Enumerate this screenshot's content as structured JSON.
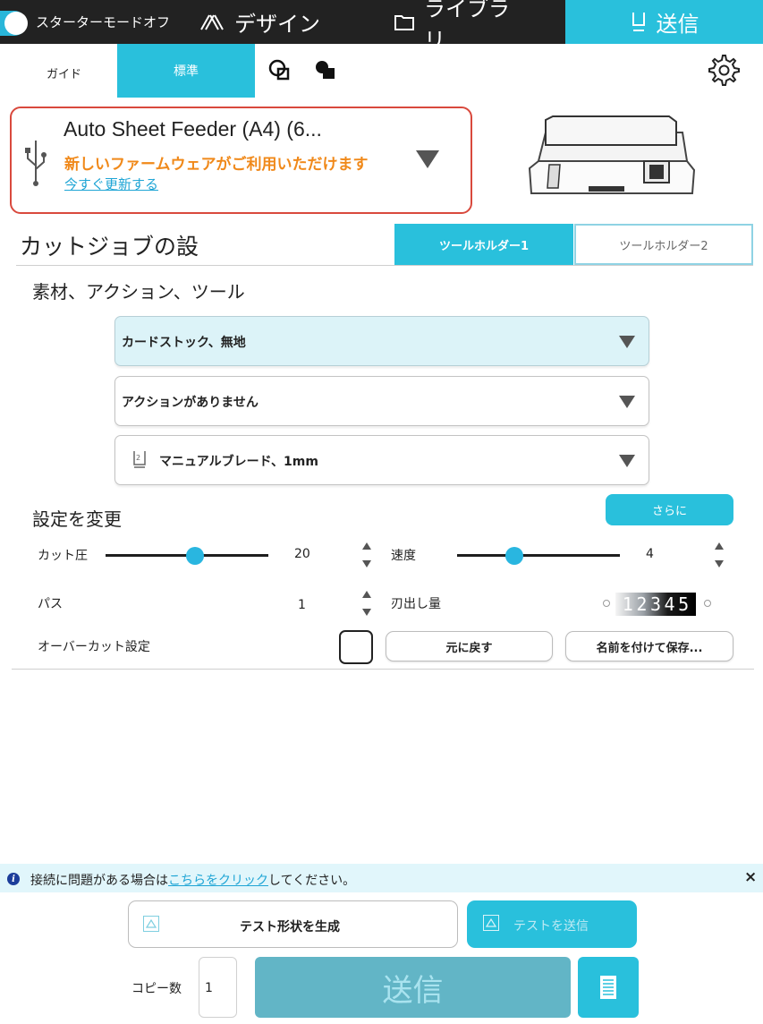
{
  "topbar": {
    "starter_mode": "スターターモードオフ",
    "tabs": [
      {
        "label": "デザイン",
        "icon": "design-icon"
      },
      {
        "label": "ライブラリ",
        "icon": "folder-icon"
      },
      {
        "label": "送信",
        "icon": "send-icon",
        "active": true
      }
    ]
  },
  "mode": {
    "guide": "ガイド",
    "standard": "標準"
  },
  "machine": {
    "name": "Auto Sheet Feeder (A4) (6...",
    "firmware_message": "新しいファームウェアがご利用いただけます",
    "update_link": "今すぐ更新する"
  },
  "cut_job": {
    "title": "カットジョブの設",
    "tool_holders": [
      "ツールホルダー1",
      "ツールホルダー2"
    ],
    "section": "素材、アクション、ツール",
    "material": "カードストック、無地",
    "action": "アクションがありません",
    "tool": "マニュアルブレード、1mm"
  },
  "settings": {
    "title": "設定を変更",
    "more_button": "さらに",
    "force_label": "カット圧",
    "force_value": "20",
    "force_level": 0.55,
    "speed_label": "速度",
    "speed_value": "4",
    "speed_level": 0.35,
    "passes_label": "パス",
    "passes_value": "1",
    "blade_depth_label": "刃出し量",
    "blade_dial_digits": [
      "1",
      "2",
      "3",
      "4",
      "5"
    ],
    "overcut_label": "オーバーカット設定",
    "reset_button": "元に戻す",
    "save_as_button": "名前を付けて保存..."
  },
  "info_bar": {
    "text_before": "接続に問題がある場合は",
    "link": "こちらをクリック",
    "text_after": "してください。",
    "close": "×"
  },
  "bottom": {
    "test_shape_button": "テスト形状を生成",
    "send_test_button": "テストを送信",
    "copies_label": "コピー数",
    "copies_value": "1",
    "send_button": "送信"
  },
  "colors": {
    "accent": "#29c0dc",
    "warning": "#f0891a",
    "link": "#1fa5d5",
    "highlight_border": "#d9493d",
    "topbar": "#222222"
  }
}
